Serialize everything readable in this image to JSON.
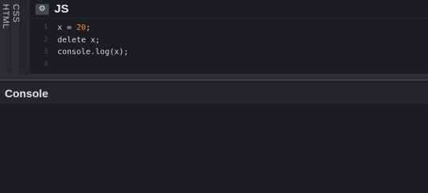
{
  "side_tabs": [
    {
      "label": "HTML"
    },
    {
      "label": "CSS"
    }
  ],
  "editor": {
    "settings_icon": "gear-icon",
    "title": "JS",
    "lines": [
      {
        "num": "1",
        "parts": [
          {
            "t": "x = ",
            "c": "plain"
          },
          {
            "t": "20",
            "c": "num"
          },
          {
            "t": ";",
            "c": "plain"
          }
        ]
      },
      {
        "num": "2",
        "parts": [
          {
            "t": "delete x;",
            "c": "plain"
          }
        ]
      },
      {
        "num": "3",
        "parts": [
          {
            "t": "console.log(x);",
            "c": "plain"
          }
        ]
      },
      {
        "num": "4",
        "parts": []
      }
    ],
    "number_color": "#f08a36"
  },
  "console": {
    "title": "Console"
  },
  "colors": {
    "background": "#1c1d20",
    "panel": "#2a2c30",
    "text": "#d6d8dc"
  }
}
